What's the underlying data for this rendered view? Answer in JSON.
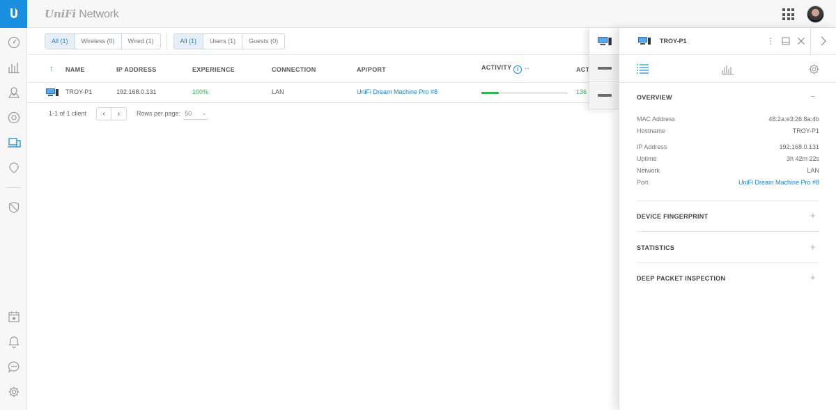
{
  "app": {
    "brand_unifi": "UniFi",
    "brand_network": "Network"
  },
  "sidebar": {
    "items": [
      "dashboard-icon",
      "statistics-icon",
      "map-icon",
      "devices-icon",
      "clients-icon",
      "insights-icon",
      "threat-management-icon",
      "events-icon",
      "alerts-icon",
      "chat-icon",
      "settings-icon"
    ],
    "active_item": "clients-icon",
    "accent_color": "#1b8fdf"
  },
  "filters": {
    "connection": [
      {
        "label": "All (1)",
        "active": true
      },
      {
        "label": "Wireless (0)",
        "active": false
      },
      {
        "label": "Wired (1)",
        "active": false
      }
    ],
    "user_type": [
      {
        "label": "All (1)",
        "active": true
      },
      {
        "label": "Users (1)",
        "active": false
      },
      {
        "label": "Guests (0)",
        "active": false
      }
    ]
  },
  "table": {
    "columns": {
      "name": "NAME",
      "ip": "IP ADDRESS",
      "experience": "EXPERIENCE",
      "connection": "CONNECTION",
      "ap_port": "AP/PORT",
      "activity": "ACTIVITY",
      "activity2": "ACT"
    },
    "rows": [
      {
        "name": "TROY-P1",
        "ip": "192.168.0.131",
        "experience": "100%",
        "connection": "LAN",
        "ap_port": "UniFi Dream Machine Pro #8",
        "activity_fraction": 0.2,
        "activity2": "136"
      }
    ],
    "pagination": {
      "count_text": "1-1 of 1 client",
      "rows_per_page_label": "Rows per page:",
      "rows_per_page_value": "50"
    }
  },
  "panel": {
    "title": "TROY-P1",
    "sections": {
      "overview": {
        "title": "OVERVIEW",
        "toggle": "−",
        "fields": [
          {
            "key": "MAC Address",
            "value": "48:2a:e3:26:8a:4b"
          },
          {
            "key": "Hostname",
            "value": "TROY-P1"
          },
          {
            "key": "IP Address",
            "value": "192.168.0.131"
          },
          {
            "key": "Uptime",
            "value": "3h 42m 22s"
          },
          {
            "key": "Network",
            "value": "LAN"
          },
          {
            "key": "Port",
            "value": "UniFi Dream Machine Pro #8"
          }
        ]
      },
      "fingerprint": {
        "title": "DEVICE FINGERPRINT",
        "toggle": "+"
      },
      "statistics": {
        "title": "STATISTICS",
        "toggle": "+"
      },
      "dpi": {
        "title": "DEEP PACKET INSPECTION",
        "toggle": "+"
      }
    }
  },
  "colors": {
    "accent": "#1b8fdf",
    "success": "#2cb34a",
    "link": "#1b7fcf"
  }
}
